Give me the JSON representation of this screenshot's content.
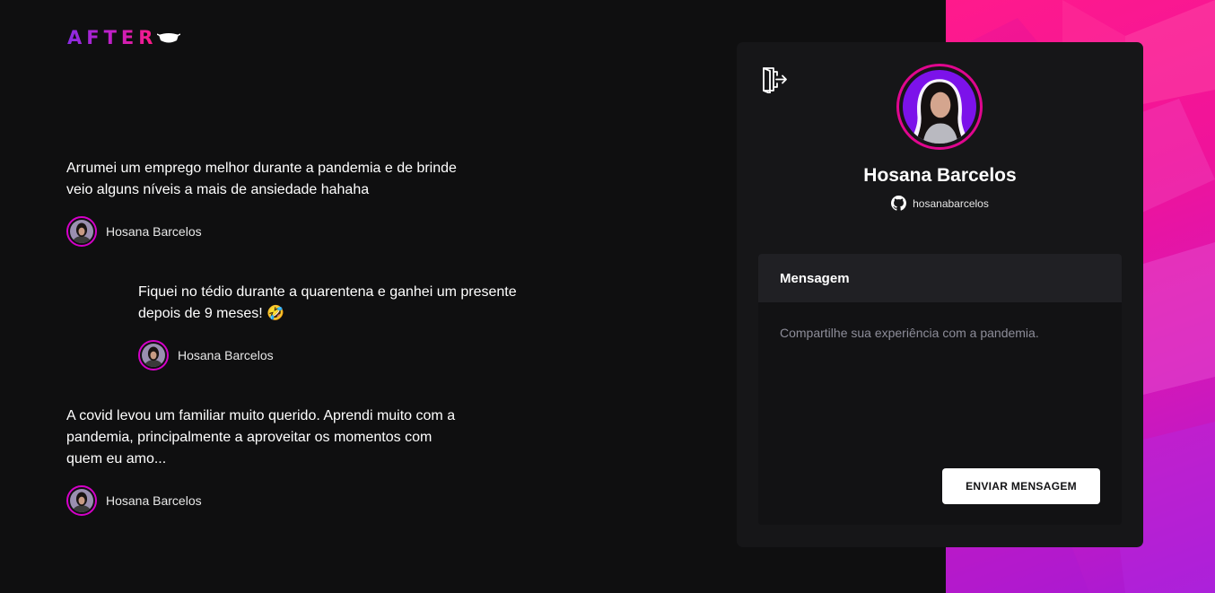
{
  "app": {
    "logo_text": "AFTER",
    "logo_icon": "face-mask-icon"
  },
  "posts": [
    {
      "text_lines": [
        "Arrumei um emprego melhor durante a pandemia e de brinde",
        "veio alguns níveis a mais de ansiedade hahaha"
      ],
      "author": "Hosana Barcelos"
    },
    {
      "text_lines": [
        "Fiquei no tédio durante a quarentena e ganhei um presente",
        "depois de 9 meses! 🤣"
      ],
      "author": "Hosana Barcelos"
    },
    {
      "text_lines": [
        "A covid levou um familiar muito querido. Aprendi muito com a",
        "pandemia, principalmente a aproveitar os momentos com",
        "quem eu amo..."
      ],
      "author": "Hosana Barcelos"
    }
  ],
  "profile": {
    "name": "Hosana Barcelos",
    "github_icon": "github-icon",
    "github_handle": "hosanabarcelos",
    "logout_icon": "sign-out-icon"
  },
  "message_form": {
    "title": "Mensagem",
    "placeholder": "Compartilhe sua experiência com a pandemia.",
    "value": "",
    "submit_label": "ENVIAR MENSAGEM"
  },
  "colors": {
    "background": "#0f0f10",
    "card": "#161618",
    "accent_pink": "#ff1a8c",
    "accent_purple": "#8a2be2",
    "avatar_ring": "#d400c8"
  }
}
